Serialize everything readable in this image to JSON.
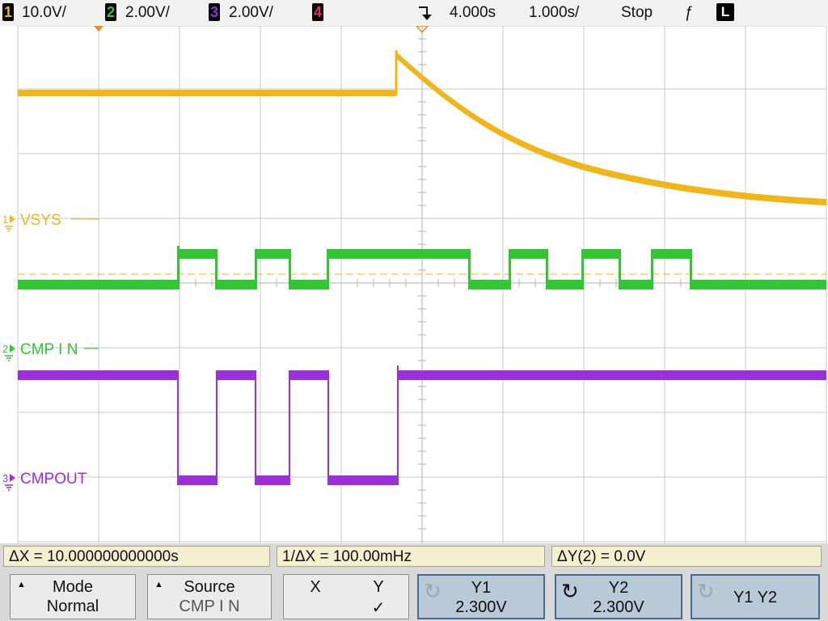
{
  "header": {
    "ch1": {
      "num": "1",
      "scale": "10.0V/",
      "color": "#f2b517"
    },
    "ch2": {
      "num": "2",
      "scale": "2.00V/",
      "color": "#33c633"
    },
    "ch3": {
      "num": "3",
      "scale": "2.00V/",
      "color": "#9b2fd9"
    },
    "ch4": {
      "num": "4",
      "color": "#e8336f"
    },
    "trigger_position": "4.000s",
    "timebase": "1.000s/",
    "run_state": "Stop",
    "trigger_slope_symbol": "ƒ",
    "trigger_mode": "L",
    "trigger_marker_icon": "trigger-arrow-icon"
  },
  "channels": {
    "vsys_label": "VSYS",
    "cmpin_label": "CMP I N",
    "cmpout_label": "CMPOUT",
    "ch1_marker": "1",
    "ch2_marker": "2",
    "ch3_marker": "3"
  },
  "measurements": {
    "dx": "ΔX = 10.000000000000s",
    "inv_dx": "1/ΔX = 100.00mHz",
    "dy": "ΔY(2) = 0.0V"
  },
  "softkeys": {
    "mode": {
      "label": "Mode",
      "value": "Normal"
    },
    "source": {
      "label": "Source",
      "value": "CMP I N"
    },
    "xy": {
      "x_label": "X",
      "y_label": "Y",
      "check": "✓"
    },
    "y1": {
      "label": "Y1",
      "value": "2.300V"
    },
    "y2": {
      "label": "Y2",
      "value": "2.300V"
    },
    "y1y2": {
      "label": "Y1 Y2"
    }
  },
  "colors": {
    "ch1": "#f2b517",
    "ch2": "#33c633",
    "ch3": "#9b2fd9",
    "ch4": "#e8336f",
    "trigger_marker": "#f08a1a",
    "grid": "#c8c8c8",
    "cursor": "#f2b517"
  }
}
